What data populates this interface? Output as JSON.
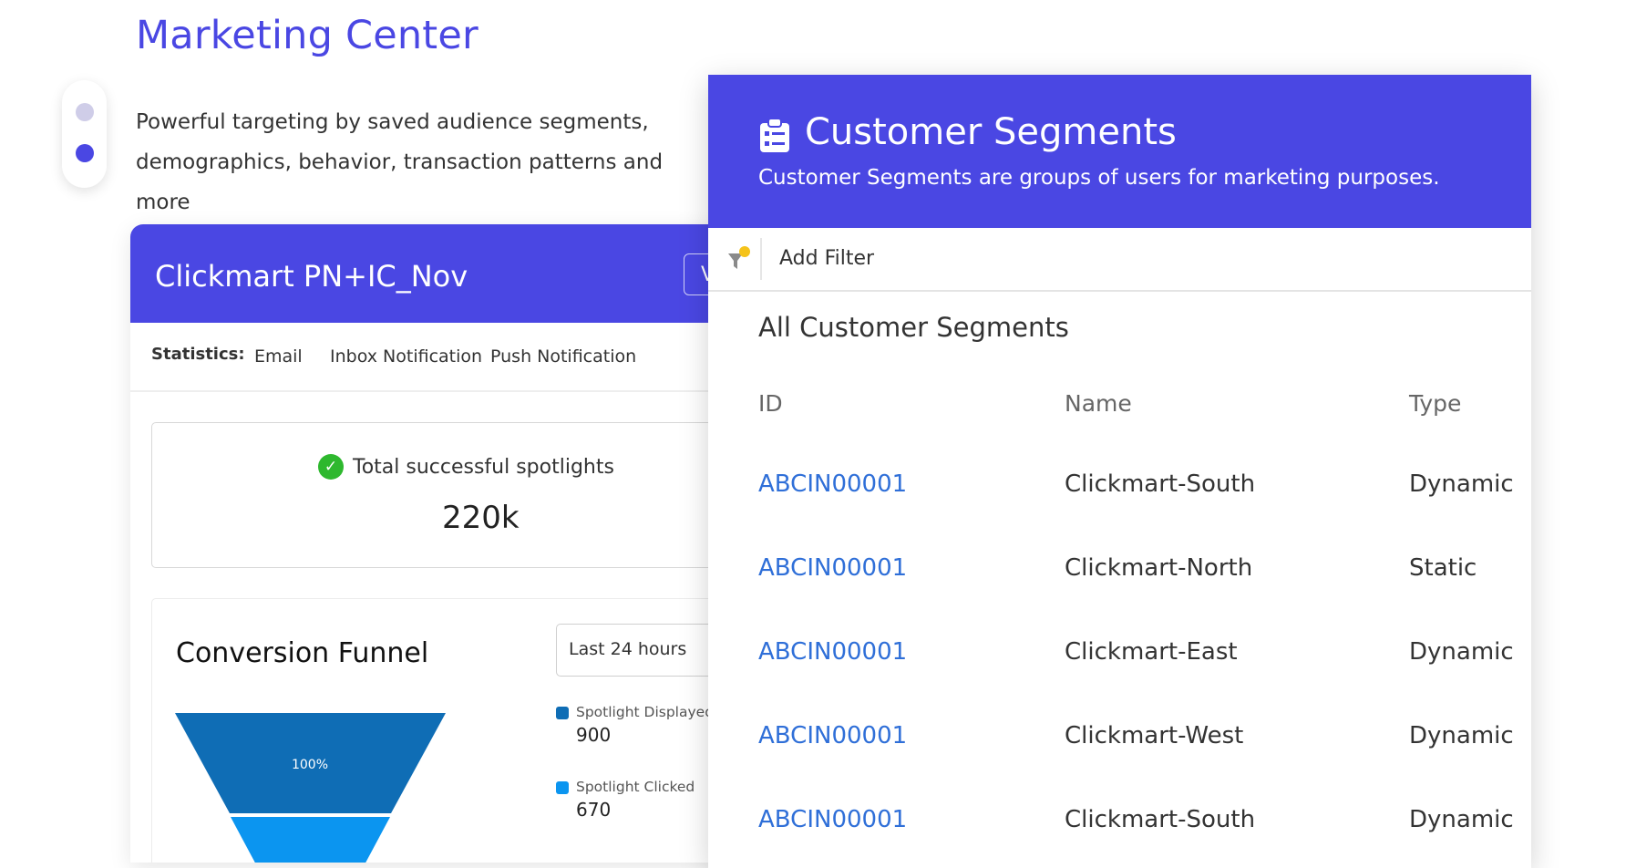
{
  "page": {
    "title": "Marketing Center",
    "intro": "Powerful targeting by saved audience segments, demographics, behavior, transaction patterns and more"
  },
  "campaign": {
    "title": "Clickmart PN+IC_Nov",
    "header_button_label": "V",
    "stats_label": "Statistics:",
    "tabs": [
      "Email",
      "Inbox Notification",
      "Push Notification"
    ],
    "spotlights": {
      "label": "Total successful spotlights",
      "value": "220k"
    },
    "funnel": {
      "title": "Conversion Funnel",
      "range": "Last 24 hours",
      "stages": [
        {
          "label": "100%",
          "color": "#0f6db5"
        },
        {
          "label": "",
          "color": "#0b95f0"
        }
      ],
      "legend": [
        {
          "name": "Spotlight Displayed",
          "value": "900",
          "color": "#0f6db5"
        },
        {
          "name": "Spotlight Clicked",
          "value": "670",
          "color": "#0b95f0"
        }
      ]
    }
  },
  "segments": {
    "title": "Customer Segments",
    "subtitle": "Customer Segments are groups of users for marketing purposes.",
    "filter_label": "Add Filter",
    "section_title": "All Customer Segments",
    "columns": [
      "ID",
      "Name",
      "Type"
    ],
    "rows": [
      {
        "id": "ABCIN00001",
        "name": "Clickmart-South",
        "type": "Dynamic"
      },
      {
        "id": "ABCIN00001",
        "name": "Clickmart-North",
        "type": "Static"
      },
      {
        "id": "ABCIN00001",
        "name": "Clickmart-East",
        "type": "Dynamic"
      },
      {
        "id": "ABCIN00001",
        "name": "Clickmart-West",
        "type": "Dynamic"
      },
      {
        "id": "ABCIN00001",
        "name": "Clickmart-South",
        "type": "Dynamic"
      }
    ]
  },
  "colors": {
    "brand": "#4a47e3",
    "link": "#2f6fd8",
    "success": "#2eb82e",
    "filter_dot": "#f5c31a"
  },
  "icons": [
    "clipboard-list-icon",
    "filter-icon",
    "check-circle-icon"
  ]
}
